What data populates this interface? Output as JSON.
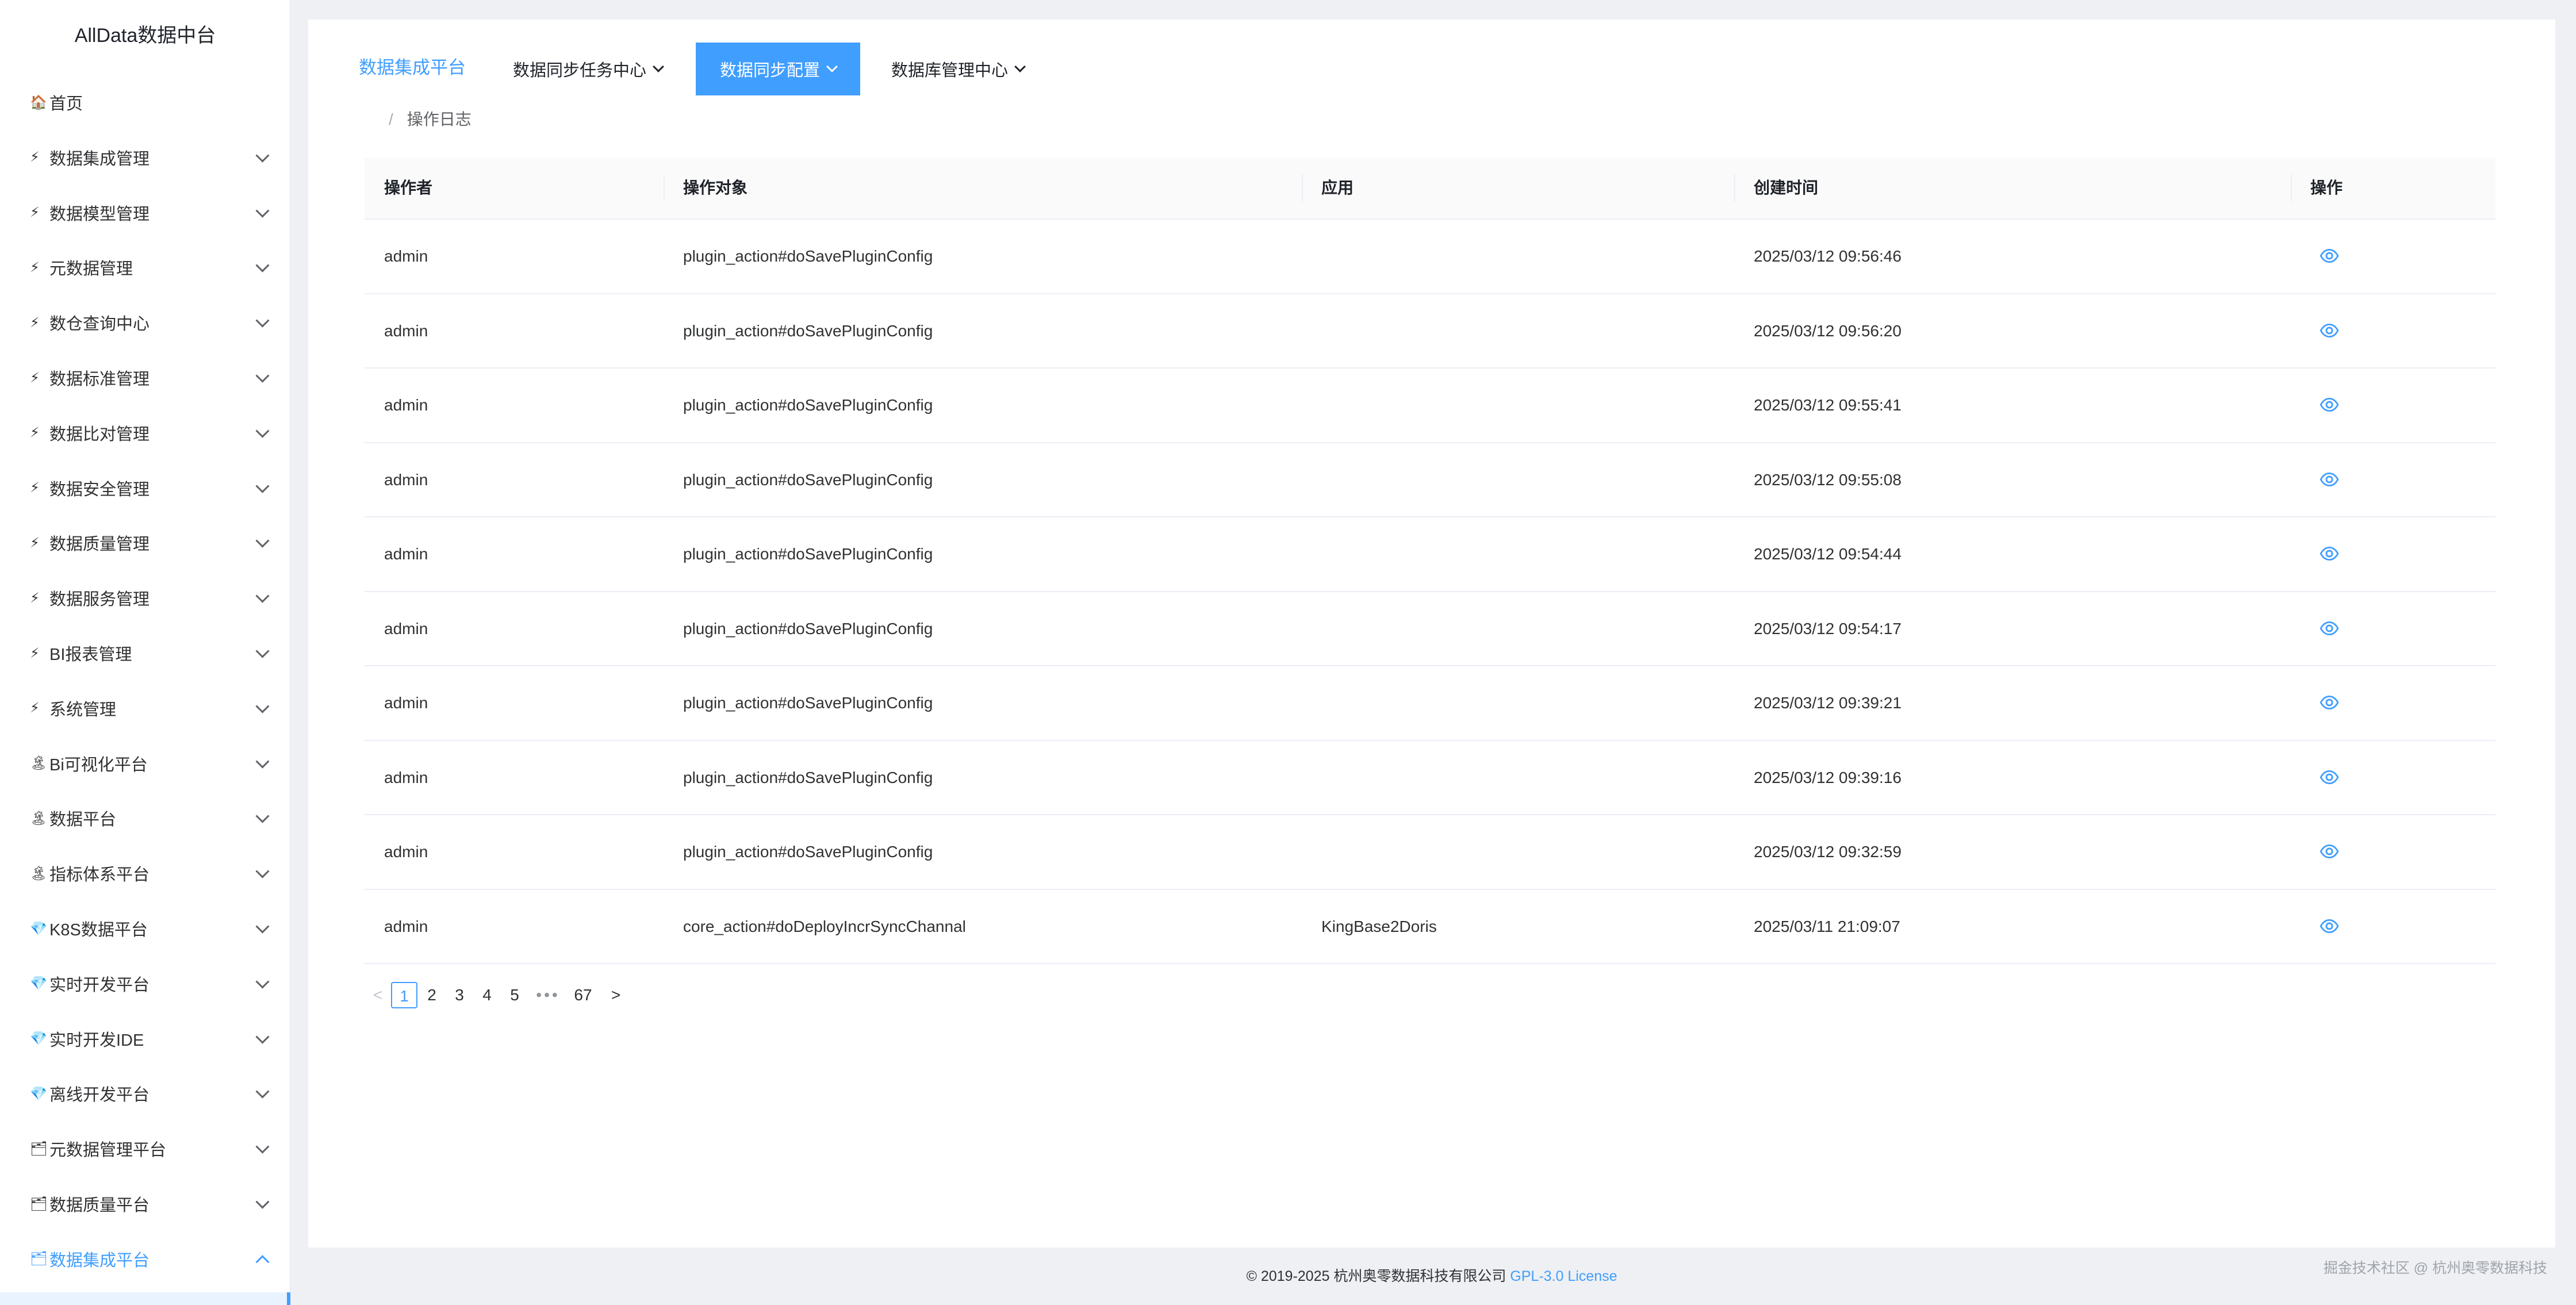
{
  "sidebar": {
    "title": "AllData数据中台",
    "items": [
      {
        "icon": "🏠",
        "label": "首页",
        "has_arrow": false,
        "active": false
      },
      {
        "icon": "⚡",
        "label": "数据集成管理",
        "has_arrow": true,
        "active": false
      },
      {
        "icon": "⚡",
        "label": "数据模型管理",
        "has_arrow": true,
        "active": false
      },
      {
        "icon": "⚡",
        "label": "元数据管理",
        "has_arrow": true,
        "active": false
      },
      {
        "icon": "⚡",
        "label": "数仓查询中心",
        "has_arrow": true,
        "active": false
      },
      {
        "icon": "⚡",
        "label": "数据标准管理",
        "has_arrow": true,
        "active": false
      },
      {
        "icon": "⚡",
        "label": "数据比对管理",
        "has_arrow": true,
        "active": false
      },
      {
        "icon": "⚡",
        "label": "数据安全管理",
        "has_arrow": true,
        "active": false
      },
      {
        "icon": "⚡",
        "label": "数据质量管理",
        "has_arrow": true,
        "active": false
      },
      {
        "icon": "⚡",
        "label": "数据服务管理",
        "has_arrow": true,
        "active": false
      },
      {
        "icon": "⚡",
        "label": "BI报表管理",
        "has_arrow": true,
        "active": false
      },
      {
        "icon": "⚡",
        "label": "系统管理",
        "has_arrow": true,
        "active": false
      },
      {
        "icon": "🏝",
        "label": "Bi可视化平台",
        "has_arrow": true,
        "active": false
      },
      {
        "icon": "🏝",
        "label": "数据平台",
        "has_arrow": true,
        "active": false
      },
      {
        "icon": "🏝",
        "label": "指标体系平台",
        "has_arrow": true,
        "active": false
      },
      {
        "icon": "💎",
        "label": "K8S数据平台",
        "has_arrow": true,
        "active": false
      },
      {
        "icon": "💎",
        "label": "实时开发平台",
        "has_arrow": true,
        "active": false
      },
      {
        "icon": "💎",
        "label": "实时开发IDE",
        "has_arrow": true,
        "active": false
      },
      {
        "icon": "💎",
        "label": "离线开发平台",
        "has_arrow": true,
        "active": false
      },
      {
        "icon": "🗂",
        "label": "元数据管理平台",
        "has_arrow": true,
        "active": false
      },
      {
        "icon": "🗂",
        "label": "数据质量平台",
        "has_arrow": true,
        "active": false
      },
      {
        "icon": "🗂",
        "label": "数据集成平台",
        "has_arrow": true,
        "active": true
      }
    ]
  },
  "topnav": {
    "platform": "数据集成平台",
    "items": [
      {
        "label": "数据同步任务中心",
        "active": false
      },
      {
        "label": "数据同步配置",
        "active": true
      },
      {
        "label": "数据库管理中心",
        "active": false
      }
    ]
  },
  "breadcrumb": {
    "separator": "/",
    "current": "操作日志"
  },
  "table": {
    "headers": [
      "操作者",
      "操作对象",
      "应用",
      "创建时间",
      "操作"
    ],
    "rows": [
      {
        "operator": "admin",
        "target": "plugin_action#doSavePluginConfig",
        "app": "",
        "created": "2025/03/12 09:56:46"
      },
      {
        "operator": "admin",
        "target": "plugin_action#doSavePluginConfig",
        "app": "",
        "created": "2025/03/12 09:56:20"
      },
      {
        "operator": "admin",
        "target": "plugin_action#doSavePluginConfig",
        "app": "",
        "created": "2025/03/12 09:55:41"
      },
      {
        "operator": "admin",
        "target": "plugin_action#doSavePluginConfig",
        "app": "",
        "created": "2025/03/12 09:55:08"
      },
      {
        "operator": "admin",
        "target": "plugin_action#doSavePluginConfig",
        "app": "",
        "created": "2025/03/12 09:54:44"
      },
      {
        "operator": "admin",
        "target": "plugin_action#doSavePluginConfig",
        "app": "",
        "created": "2025/03/12 09:54:17"
      },
      {
        "operator": "admin",
        "target": "plugin_action#doSavePluginConfig",
        "app": "",
        "created": "2025/03/12 09:39:21"
      },
      {
        "operator": "admin",
        "target": "plugin_action#doSavePluginConfig",
        "app": "",
        "created": "2025/03/12 09:39:16"
      },
      {
        "operator": "admin",
        "target": "plugin_action#doSavePluginConfig",
        "app": "",
        "created": "2025/03/12 09:32:59"
      },
      {
        "operator": "admin",
        "target": "core_action#doDeployIncrSyncChannal",
        "app": "KingBase2Doris",
        "created": "2025/03/11 21:09:07"
      }
    ],
    "action_icon": "eye-icon"
  },
  "pagination": {
    "prev": "<",
    "next": ">",
    "pages": [
      "1",
      "2",
      "3",
      "4",
      "5"
    ],
    "ellipsis": "•••",
    "last": "67",
    "current": "1"
  },
  "footer": {
    "copyright": "© 2019-2025 杭州奥零数据科技有限公司 ",
    "license_link": "GPL-3.0 License",
    "watermark": "掘金技术社区 @ 杭州奥零数据科技"
  },
  "colors": {
    "accent": "#409eff",
    "text": "#303133",
    "border": "#ebeef5",
    "background": "#eef0f3"
  }
}
